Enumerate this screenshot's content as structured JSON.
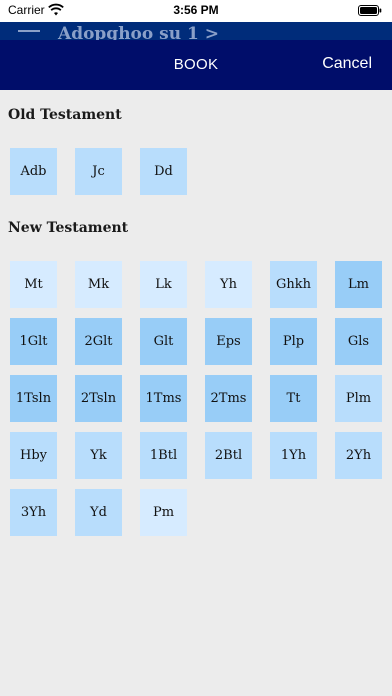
{
  "status_bar": {
    "carrier": "Carrier",
    "time": "3:56 PM"
  },
  "behind": {
    "title": "Adopghoo su 1 >"
  },
  "nav": {
    "title": "BOOK",
    "cancel_label": "Cancel"
  },
  "colors": {
    "light": "#d6ebff",
    "mid": "#b8ddfc",
    "dark": "#98cdf7",
    "nav": "#000d6a"
  },
  "old_testament": {
    "title": "Old Testament",
    "books": [
      {
        "label": "Adb",
        "shade": "mid"
      },
      {
        "label": "Jc",
        "shade": "mid"
      },
      {
        "label": "Dd",
        "shade": "mid"
      }
    ]
  },
  "new_testament": {
    "title": "New Testament",
    "books": [
      {
        "label": "Mt",
        "shade": "light"
      },
      {
        "label": "Mk",
        "shade": "light"
      },
      {
        "label": "Lk",
        "shade": "light"
      },
      {
        "label": "Yh",
        "shade": "light"
      },
      {
        "label": "Ghkh",
        "shade": "mid"
      },
      {
        "label": "Lm",
        "shade": "dark"
      },
      {
        "label": "1Glt",
        "shade": "dark"
      },
      {
        "label": "2Glt",
        "shade": "dark"
      },
      {
        "label": "Glt",
        "shade": "dark"
      },
      {
        "label": "Eps",
        "shade": "dark"
      },
      {
        "label": "Plp",
        "shade": "dark"
      },
      {
        "label": "Gls",
        "shade": "dark"
      },
      {
        "label": "1Tsln",
        "shade": "dark"
      },
      {
        "label": "2Tsln",
        "shade": "dark"
      },
      {
        "label": "1Tms",
        "shade": "dark"
      },
      {
        "label": "2Tms",
        "shade": "dark"
      },
      {
        "label": "Tt",
        "shade": "dark"
      },
      {
        "label": "Plm",
        "shade": "mid"
      },
      {
        "label": "Hby",
        "shade": "mid"
      },
      {
        "label": "Yk",
        "shade": "mid"
      },
      {
        "label": "1Btl",
        "shade": "mid"
      },
      {
        "label": "2Btl",
        "shade": "mid"
      },
      {
        "label": "1Yh",
        "shade": "mid"
      },
      {
        "label": "2Yh",
        "shade": "mid"
      },
      {
        "label": "3Yh",
        "shade": "mid"
      },
      {
        "label": "Yd",
        "shade": "mid"
      },
      {
        "label": "Pm",
        "shade": "light"
      }
    ]
  }
}
